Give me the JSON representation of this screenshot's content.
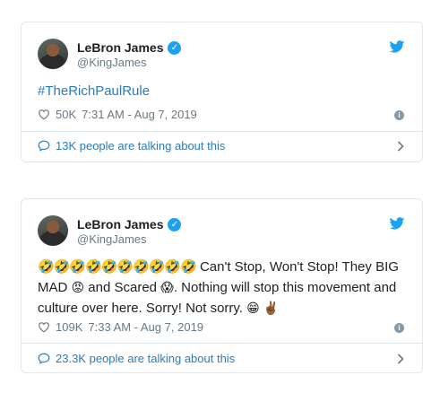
{
  "colors": {
    "link": "#2b7bb9",
    "verified": "#1da1f2",
    "muted": "#697882",
    "border": "#e1e8ed"
  },
  "tweets": [
    {
      "author_name": "LeBron James",
      "author_handle": "@KingJames",
      "text": "#TheRichPaulRule",
      "likes": "50K",
      "timestamp": "7:31 AM - Aug 7, 2019",
      "talking": "13K people are talking about this"
    },
    {
      "author_name": "LeBron James",
      "author_handle": "@KingJames",
      "emoji_prefix": "🤣🤣🤣🤣🤣🤣🤣🤣🤣🤣",
      "text_part1": "Can't Stop, Won't Stop! They BIG MAD",
      "emoji_mad": "😡",
      "text_part2": "and Scared",
      "emoji_scared": "😱",
      "text_part3": ". Nothing will stop this movement and culture over here. Sorry! Not sorry.",
      "emoji_grin": "😁",
      "emoji_peace": "✌🏾",
      "likes": "109K",
      "timestamp": "7:33 AM - Aug 7, 2019",
      "talking": "23.3K people are talking about this"
    }
  ],
  "icons": {
    "verified": "verified-badge-icon",
    "platform": "twitter-bird-icon",
    "like": "heart-icon",
    "info": "info-icon",
    "replies": "speech-bubble-icon",
    "more": "chevron-right-icon"
  }
}
